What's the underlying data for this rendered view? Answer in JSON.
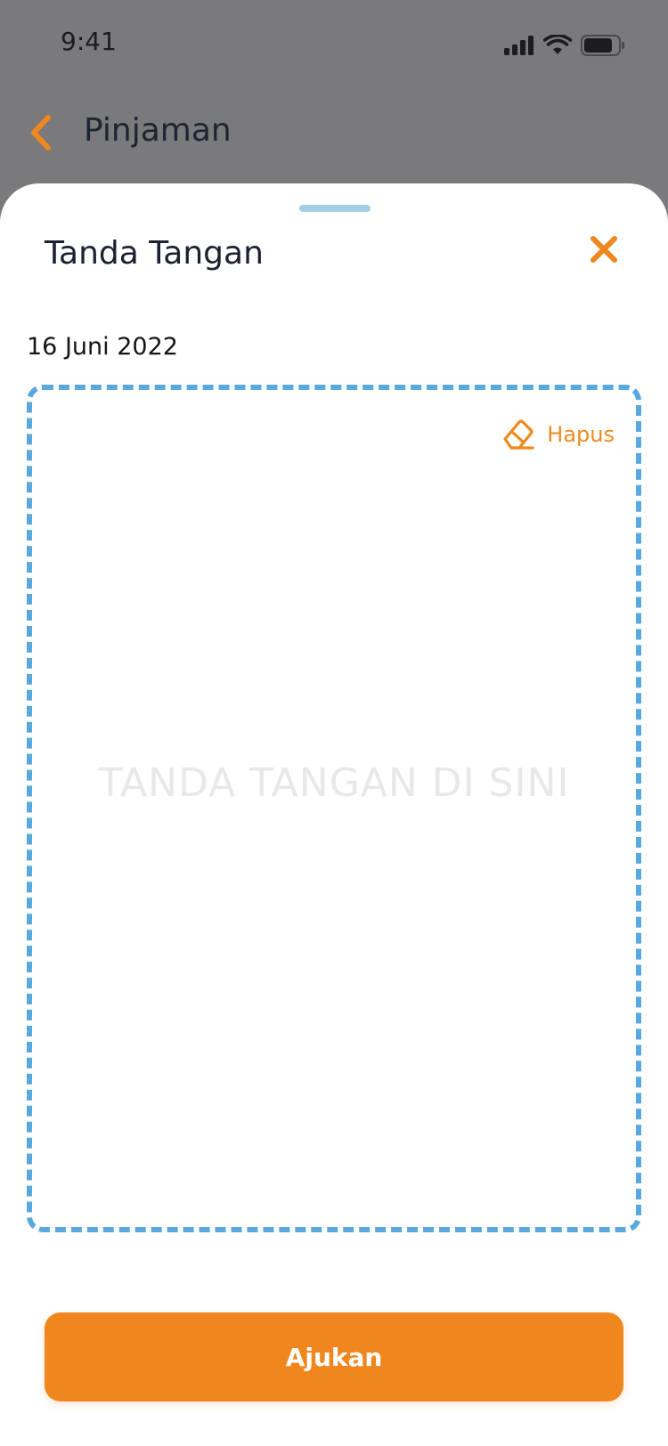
{
  "status_bar": {
    "time": "9:41",
    "icons": [
      "signal-icon",
      "wifi-icon",
      "battery-icon"
    ]
  },
  "header": {
    "title": "Pinjaman",
    "back_icon": "chevron-left-icon"
  },
  "sheet": {
    "title": "Tanda Tangan",
    "close_icon": "close-icon",
    "date": "16 Juni 2022",
    "signature_pad": {
      "placeholder": "TANDA TANGAN DI SINI",
      "clear_label": "Hapus",
      "clear_icon": "eraser-icon"
    },
    "submit_label": "Ajukan"
  },
  "colors": {
    "accent": "#F0861E",
    "dash_border": "#5AA9DD",
    "overlay": "#7A7A7C",
    "handle": "#A4CDE6"
  }
}
